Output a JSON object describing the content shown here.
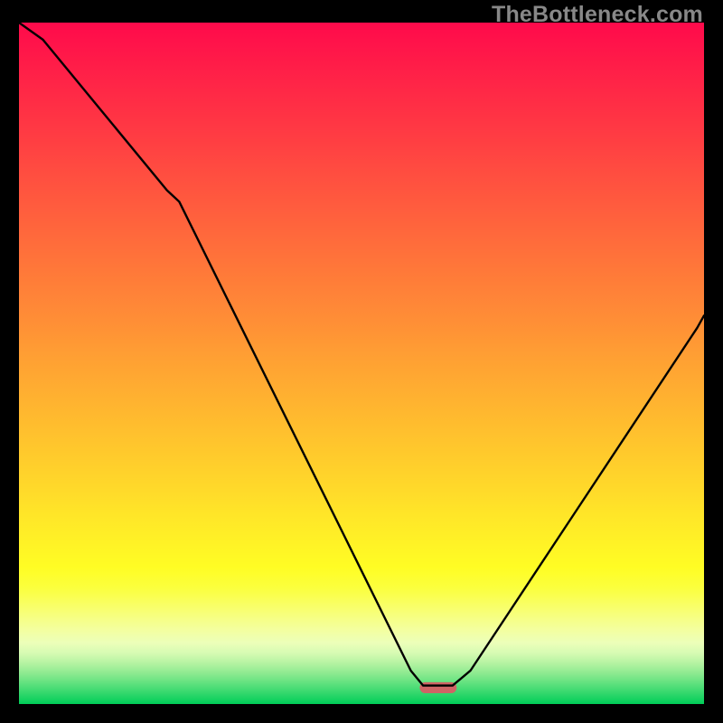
{
  "watermark": "TheBottleneck.com",
  "chart_data": {
    "type": "line",
    "title": "",
    "xlabel": "",
    "ylabel": "",
    "xlim": [
      0,
      100
    ],
    "ylim": [
      0,
      100
    ],
    "grid": false,
    "gradient": "red-to-green-vertical",
    "curve_note": "static V-shaped curve crossing from top-left down to a flat trough near x≈62 of plot width at y≈0, then rising to the right edge at roughly y≈55 of plot height; no axis ticks, labels, or legend are shown",
    "series": [
      {
        "name": "profile",
        "x": [
          0,
          3.5,
          21.6,
          23.4,
          57.2,
          59.0,
          63.3,
          65.9,
          99.0,
          100
        ],
        "y": [
          100,
          97.5,
          75.4,
          73.7,
          4.9,
          2.7,
          2.7,
          4.9,
          55.2,
          57.0
        ]
      }
    ],
    "marker": {
      "x": 61.2,
      "y": 2.4,
      "width_pct": 5.4,
      "height_pct": 1.6,
      "color": "#cf6465"
    }
  },
  "gradient": {
    "stops": [
      {
        "offset": 0.0,
        "color": "#ff0a4b"
      },
      {
        "offset": 0.03,
        "color": "#ff134a"
      },
      {
        "offset": 0.06,
        "color": "#ff1c48"
      },
      {
        "offset": 0.09,
        "color": "#ff2547"
      },
      {
        "offset": 0.12,
        "color": "#ff2e45"
      },
      {
        "offset": 0.15,
        "color": "#ff3744"
      },
      {
        "offset": 0.18,
        "color": "#ff4042"
      },
      {
        "offset": 0.21,
        "color": "#ff4a41"
      },
      {
        "offset": 0.24,
        "color": "#ff533f"
      },
      {
        "offset": 0.27,
        "color": "#ff5c3e"
      },
      {
        "offset": 0.3,
        "color": "#ff653c"
      },
      {
        "offset": 0.33,
        "color": "#ff6e3b"
      },
      {
        "offset": 0.36,
        "color": "#ff7739"
      },
      {
        "offset": 0.39,
        "color": "#ff8038"
      },
      {
        "offset": 0.42,
        "color": "#ff8937"
      },
      {
        "offset": 0.45,
        "color": "#ff9235"
      },
      {
        "offset": 0.48,
        "color": "#ff9c34"
      },
      {
        "offset": 0.51,
        "color": "#ffa532"
      },
      {
        "offset": 0.54,
        "color": "#ffae31"
      },
      {
        "offset": 0.57,
        "color": "#ffb72f"
      },
      {
        "offset": 0.6,
        "color": "#ffc02e"
      },
      {
        "offset": 0.63,
        "color": "#ffc92c"
      },
      {
        "offset": 0.66,
        "color": "#ffd22b"
      },
      {
        "offset": 0.69,
        "color": "#ffdb2a"
      },
      {
        "offset": 0.72,
        "color": "#ffe528"
      },
      {
        "offset": 0.75,
        "color": "#ffee27"
      },
      {
        "offset": 0.78,
        "color": "#fff725"
      },
      {
        "offset": 0.8,
        "color": "#fffd24"
      },
      {
        "offset": 0.83,
        "color": "#fbff3e"
      },
      {
        "offset": 0.86,
        "color": "#f8ff6e"
      },
      {
        "offset": 0.89,
        "color": "#f4ff9e"
      },
      {
        "offset": 0.91,
        "color": "#ecffb9"
      },
      {
        "offset": 0.925,
        "color": "#d7fbb3"
      },
      {
        "offset": 0.94,
        "color": "#b5f3a2"
      },
      {
        "offset": 0.955,
        "color": "#8dea90"
      },
      {
        "offset": 0.97,
        "color": "#5fe17e"
      },
      {
        "offset": 0.985,
        "color": "#30d76b"
      },
      {
        "offset": 1.0,
        "color": "#00cd58"
      }
    ]
  }
}
